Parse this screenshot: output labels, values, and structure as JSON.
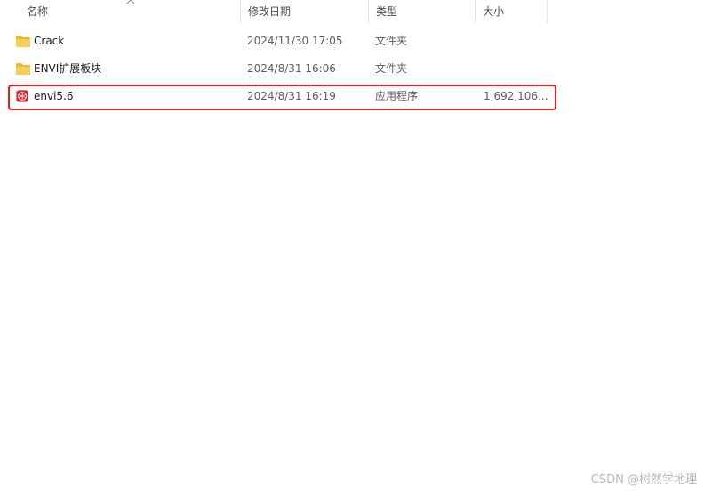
{
  "columns": {
    "name": "名称",
    "date": "修改日期",
    "type": "类型",
    "size": "大小"
  },
  "files": [
    {
      "name": "Crack",
      "date": "2024/11/30 17:05",
      "type": "文件夹",
      "size": "",
      "icon": "folder-icon"
    },
    {
      "name": "ENVI扩展板块",
      "date": "2024/8/31 16:06",
      "type": "文件夹",
      "size": "",
      "icon": "folder-icon"
    },
    {
      "name": "envi5.6",
      "date": "2024/8/31 16:19",
      "type": "应用程序",
      "size": "1,692,106...",
      "icon": "envi-app-icon"
    }
  ],
  "colors": {
    "highlight": "#e8201f",
    "folder": "#f5c842",
    "app_icon": "#d9262b"
  },
  "watermark": "CSDN @树然学地理"
}
